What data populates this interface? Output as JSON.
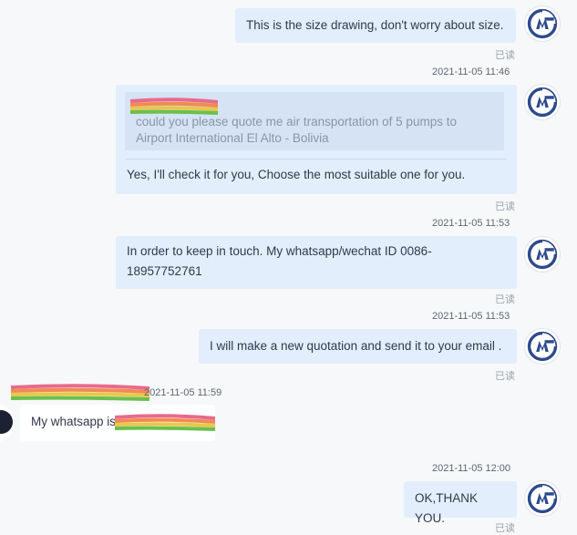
{
  "messages": {
    "m1": {
      "text": "This is the size drawing, don't worry about size.",
      "status": "已读"
    },
    "m2": {
      "timestamp": "2021-11-05 11:46",
      "quoted_text": "could you please quote me air transportation of 5 pumps to Airport International El Alto - Bolivia",
      "text": "Yes, I'll check it for you, Choose the most suitable one for you.",
      "status": "已读"
    },
    "m3": {
      "timestamp": "2021-11-05 11:53",
      "text": "In order to keep in touch. My whatsapp/wechat ID 0086-18957752761",
      "status": "已读"
    },
    "m4": {
      "timestamp": "2021-11-05 11:53",
      "text": "I will make a new quotation and send it to your email .",
      "status": "已读"
    },
    "m5": {
      "timestamp": "2021-11-05 11:59",
      "text": "My whatsapp is"
    },
    "m6": {
      "timestamp": "2021-11-05 12:00",
      "text": "OK,THANK YOU.",
      "status": "已读"
    }
  },
  "colors": {
    "outgoing_bubble": "#e2eefc",
    "incoming_bubble": "#ffffff",
    "avatar_logo": "#2d4a8c"
  },
  "icons": {
    "agent_avatar": "company-logo-icon",
    "customer_avatar": "avatar",
    "redaction": "redaction-scribble"
  }
}
